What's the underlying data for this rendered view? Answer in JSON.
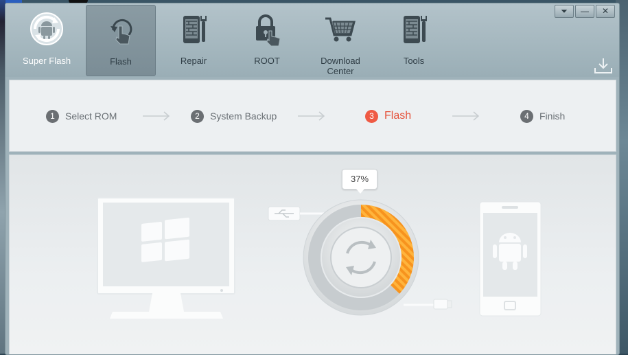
{
  "toolbar": {
    "items": [
      {
        "label": "Super Flash",
        "icon": "android-sync-icon"
      },
      {
        "label": "Flash",
        "icon": "touch-refresh-icon"
      },
      {
        "label": "Repair",
        "icon": "phone-wrench-icon"
      },
      {
        "label": "ROOT",
        "icon": "lock-hand-icon"
      },
      {
        "label": "Download Center",
        "icon": "shopping-cart-icon"
      },
      {
        "label": "Tools",
        "icon": "phone-tools-icon"
      }
    ],
    "active_index": 1
  },
  "window_controls": {
    "menu": "⏷",
    "minimize": "—",
    "close": "✕"
  },
  "steps": [
    {
      "num": "1",
      "label": "Select ROM"
    },
    {
      "num": "2",
      "label": "System Backup"
    },
    {
      "num": "3",
      "label": "Flash"
    },
    {
      "num": "4",
      "label": "Finish"
    }
  ],
  "current_step": 3,
  "progress": {
    "percent_label": "37%",
    "value": 0.37
  },
  "colors": {
    "accent": "#ef5a44",
    "progress_orange": "#f7931e"
  }
}
